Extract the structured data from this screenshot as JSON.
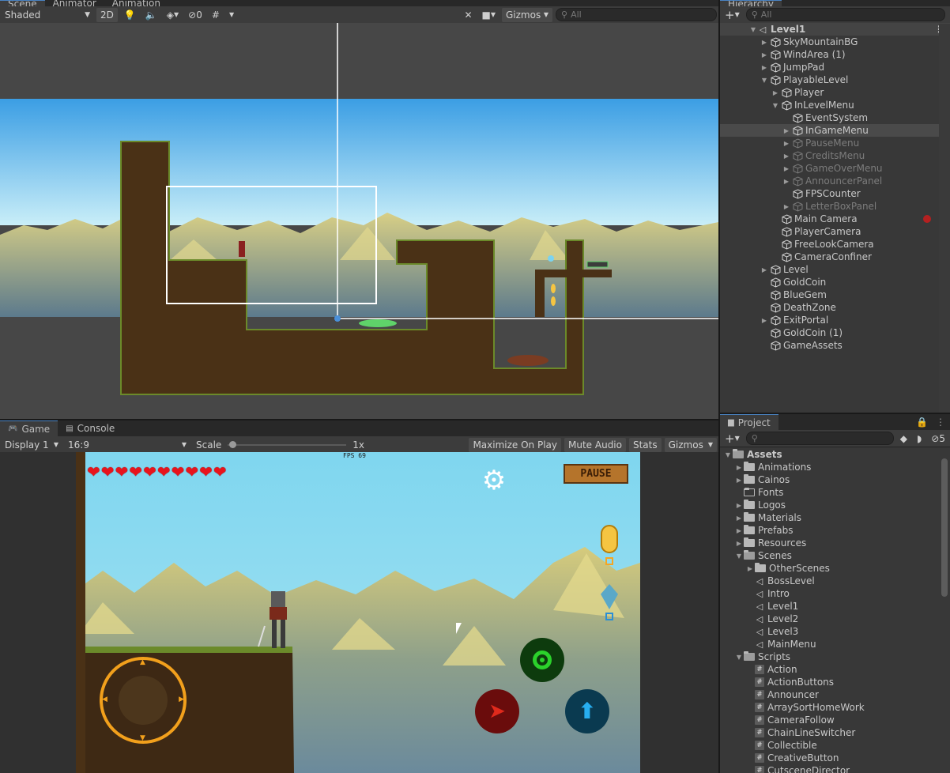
{
  "scene_tabs": [
    "Scene",
    "Animator",
    "Animation"
  ],
  "scene_toolbar": {
    "shading": "Shaded",
    "mode_2d": "2D",
    "hidden_count": "0",
    "gizmos": "Gizmos",
    "search_placeholder": "All"
  },
  "hierarchy": {
    "tab": "Hierarchy",
    "search_placeholder": "All",
    "items": [
      {
        "label": "Level1",
        "indent": 0,
        "arrow": "open",
        "type": "scene",
        "style": "hdr"
      },
      {
        "label": "SkyMountainBG",
        "indent": 1,
        "arrow": "closed",
        "type": "cube"
      },
      {
        "label": "WindArea (1)",
        "indent": 1,
        "arrow": "closed",
        "type": "cube"
      },
      {
        "label": "JumpPad",
        "indent": 1,
        "arrow": "closed",
        "type": "cube"
      },
      {
        "label": "PlayableLevel",
        "indent": 1,
        "arrow": "open",
        "type": "cube"
      },
      {
        "label": "Player",
        "indent": 2,
        "arrow": "closed",
        "type": "cube"
      },
      {
        "label": "InLevelMenu",
        "indent": 2,
        "arrow": "open",
        "type": "cube"
      },
      {
        "label": "EventSystem",
        "indent": 3,
        "arrow": "none",
        "type": "cube"
      },
      {
        "label": "InGameMenu",
        "indent": 3,
        "arrow": "closed",
        "type": "cube",
        "style": "sel"
      },
      {
        "label": "PauseMenu",
        "indent": 3,
        "arrow": "closed",
        "type": "cube",
        "style": "dim"
      },
      {
        "label": "CreditsMenu",
        "indent": 3,
        "arrow": "closed",
        "type": "cube",
        "style": "dim"
      },
      {
        "label": "GameOverMenu",
        "indent": 3,
        "arrow": "closed",
        "type": "cube",
        "style": "dim"
      },
      {
        "label": "AnnouncerPanel",
        "indent": 3,
        "arrow": "closed",
        "type": "cube",
        "style": "dim"
      },
      {
        "label": "FPSCounter",
        "indent": 3,
        "arrow": "none",
        "type": "cube"
      },
      {
        "label": "LetterBoxPanel",
        "indent": 3,
        "arrow": "closed",
        "type": "cube",
        "style": "dim"
      },
      {
        "label": "Main Camera",
        "indent": 2,
        "arrow": "none",
        "type": "cube",
        "badge": true
      },
      {
        "label": "PlayerCamera",
        "indent": 2,
        "arrow": "none",
        "type": "cube"
      },
      {
        "label": "FreeLookCamera",
        "indent": 2,
        "arrow": "none",
        "type": "cube"
      },
      {
        "label": "CameraConfiner",
        "indent": 2,
        "arrow": "none",
        "type": "cube"
      },
      {
        "label": "Level",
        "indent": 1,
        "arrow": "closed",
        "type": "cube"
      },
      {
        "label": "GoldCoin",
        "indent": 1,
        "arrow": "none",
        "type": "cube"
      },
      {
        "label": "BlueGem",
        "indent": 1,
        "arrow": "none",
        "type": "cube"
      },
      {
        "label": "DeathZone",
        "indent": 1,
        "arrow": "none",
        "type": "cube"
      },
      {
        "label": "ExitPortal",
        "indent": 1,
        "arrow": "closed",
        "type": "cube"
      },
      {
        "label": "GoldCoin (1)",
        "indent": 1,
        "arrow": "none",
        "type": "cube"
      },
      {
        "label": "GameAssets",
        "indent": 1,
        "arrow": "none",
        "type": "cube"
      }
    ]
  },
  "game_tabs": {
    "game": "Game",
    "console": "Console"
  },
  "game_toolbar": {
    "display": "Display 1",
    "aspect": "16:9",
    "scale_label": "Scale",
    "scale_value": "1x",
    "maximize": "Maximize On Play",
    "mute": "Mute Audio",
    "stats": "Stats",
    "gizmos": "Gizmos"
  },
  "game": {
    "fps": "FPS 69",
    "pause": "PAUSE",
    "hearts": 10
  },
  "project": {
    "tab": "Project",
    "hidden_count": "5",
    "items": [
      {
        "label": "Assets",
        "indent": 0,
        "arrow": "open",
        "type": "folder-open",
        "bold": true
      },
      {
        "label": "Animations",
        "indent": 1,
        "arrow": "closed",
        "type": "folder"
      },
      {
        "label": "Cainos",
        "indent": 1,
        "arrow": "closed",
        "type": "folder"
      },
      {
        "label": "Fonts",
        "indent": 1,
        "arrow": "none",
        "type": "folder-empty"
      },
      {
        "label": "Logos",
        "indent": 1,
        "arrow": "closed",
        "type": "folder"
      },
      {
        "label": "Materials",
        "indent": 1,
        "arrow": "closed",
        "type": "folder"
      },
      {
        "label": "Prefabs",
        "indent": 1,
        "arrow": "closed",
        "type": "folder"
      },
      {
        "label": "Resources",
        "indent": 1,
        "arrow": "closed",
        "type": "folder"
      },
      {
        "label": "Scenes",
        "indent": 1,
        "arrow": "open",
        "type": "folder-open"
      },
      {
        "label": "OtherScenes",
        "indent": 2,
        "arrow": "closed",
        "type": "folder"
      },
      {
        "label": "BossLevel",
        "indent": 2,
        "arrow": "none",
        "type": "scene"
      },
      {
        "label": "Intro",
        "indent": 2,
        "arrow": "none",
        "type": "scene"
      },
      {
        "label": "Level1",
        "indent": 2,
        "arrow": "none",
        "type": "scene"
      },
      {
        "label": "Level2",
        "indent": 2,
        "arrow": "none",
        "type": "scene"
      },
      {
        "label": "Level3",
        "indent": 2,
        "arrow": "none",
        "type": "scene"
      },
      {
        "label": "MainMenu",
        "indent": 2,
        "arrow": "none",
        "type": "scene"
      },
      {
        "label": "Scripts",
        "indent": 1,
        "arrow": "open",
        "type": "folder-open"
      },
      {
        "label": "Action",
        "indent": 2,
        "arrow": "none",
        "type": "script"
      },
      {
        "label": "ActionButtons",
        "indent": 2,
        "arrow": "none",
        "type": "script"
      },
      {
        "label": "Announcer",
        "indent": 2,
        "arrow": "none",
        "type": "script"
      },
      {
        "label": "ArraySortHomeWork",
        "indent": 2,
        "arrow": "none",
        "type": "script"
      },
      {
        "label": "CameraFollow",
        "indent": 2,
        "arrow": "none",
        "type": "script"
      },
      {
        "label": "ChainLineSwitcher",
        "indent": 2,
        "arrow": "none",
        "type": "script"
      },
      {
        "label": "Collectible",
        "indent": 2,
        "arrow": "none",
        "type": "script"
      },
      {
        "label": "CreativeButton",
        "indent": 2,
        "arrow": "none",
        "type": "script"
      },
      {
        "label": "CutsceneDirector",
        "indent": 2,
        "arrow": "none",
        "type": "script"
      }
    ]
  },
  "colors": {
    "sky": "#7fd6ef",
    "dirt": "#4a3116",
    "grass": "#6b8a2a",
    "joystick": "#f2a01c",
    "attack_button": "#6a0c0c",
    "jump_button": "#0a3a50",
    "action_button": "#0d3b0d"
  }
}
